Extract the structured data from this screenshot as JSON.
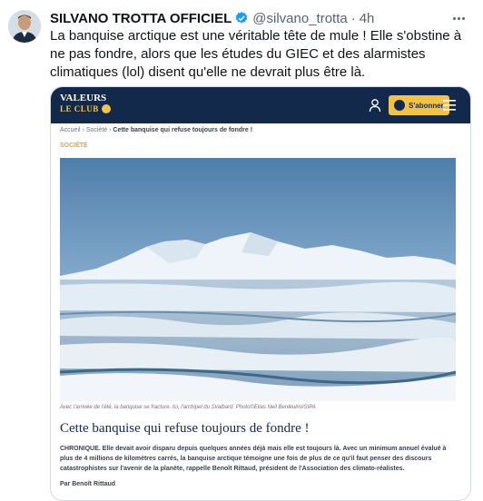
{
  "tweet": {
    "author_name": "SILVANO TROTTA OFFICIEL",
    "handle": "@silvano_trotta",
    "separator": "·",
    "time": "4h",
    "text": "La banquise arctique est une véritable tête de mule ! Elle s'obstine à ne pas fondre, alors que les études du GIEC et des alarmistes climatiques (lol) disent qu'elle ne devrait plus être là."
  },
  "card": {
    "site_logo_line1": "VALEURS",
    "site_logo_line2": "LE CLUB",
    "subscribe_label": "S'abonner",
    "breadcrumb_home": "Accueil",
    "breadcrumb_section": "Société",
    "breadcrumb_current": "Cette banquise qui refuse toujours de fondre !",
    "breadcrumb_sep": " › ",
    "section_tag": "SOCIÉTÉ",
    "photo_caption": "Avec l'arrivée de l'été, la banquise se fracture. Ici, l'archipel du Svalbard. Photo©Elias Neil Benleulmi/SIPA",
    "article_title": "Cette banquise qui refuse toujours de fondre !",
    "article_lead": "CHRONIQUE. Elle devait avoir disparu depuis quelques années déjà mais elle est toujours là. Avec un minimum annuel évalué à plus de 4 millions de kilomètres carrés, la banquise arctique témoigne une fois de plus de ce qu'il faut penser des discours catastrophistes sur l'avenir de la planète, rappelle Benoît Rittaud, président de l'Association des climato-réalistes.",
    "byline": "Par Benoît Rittaud"
  },
  "colors": {
    "brand_navy": "#13294b",
    "brand_gold": "#f2c34a",
    "verified_blue": "#1d9bf0"
  }
}
